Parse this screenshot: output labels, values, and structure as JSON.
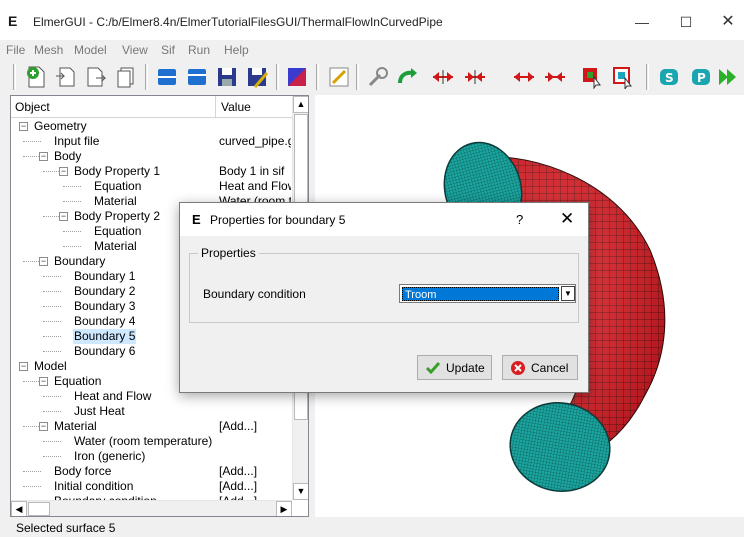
{
  "window": {
    "title": "ElmerGUI - C:/b/Elmer8.4n/ElmerTutorialFilesGUI/ThermalFlowInCurvedPipe",
    "logo": "E",
    "minimize": "—",
    "maximize": "☐",
    "close": "✕"
  },
  "menu": [
    "File",
    "Mesh",
    "Model",
    "View",
    "Sif",
    "Run",
    "Help"
  ],
  "tree": {
    "headers": {
      "object": "Object",
      "value": "Value"
    },
    "rows": [
      {
        "label": "Geometry",
        "value": "",
        "level": 0,
        "expander": "−"
      },
      {
        "label": "Input file",
        "value": "curved_pipe.g",
        "level": 1,
        "expander": ""
      },
      {
        "label": "Body",
        "value": "",
        "level": 1,
        "expander": "−"
      },
      {
        "label": "Body Property 1",
        "value": "Body 1 in sif",
        "level": 2,
        "expander": "−"
      },
      {
        "label": "Equation",
        "value": "Heat and Flow",
        "level": 3,
        "expander": ""
      },
      {
        "label": "Material",
        "value": "Water (room t",
        "level": 3,
        "expander": ""
      },
      {
        "label": "Body Property 2",
        "value": "",
        "level": 2,
        "expander": "−"
      },
      {
        "label": "Equation",
        "value": "",
        "level": 3,
        "expander": ""
      },
      {
        "label": "Material",
        "value": "",
        "level": 3,
        "expander": ""
      },
      {
        "label": "Boundary",
        "value": "",
        "level": 1,
        "expander": "−"
      },
      {
        "label": "Boundary 1",
        "value": "",
        "level": 2,
        "expander": ""
      },
      {
        "label": "Boundary 2",
        "value": "",
        "level": 2,
        "expander": ""
      },
      {
        "label": "Boundary 3",
        "value": "",
        "level": 2,
        "expander": ""
      },
      {
        "label": "Boundary 4",
        "value": "",
        "level": 2,
        "expander": ""
      },
      {
        "label": "Boundary 5",
        "value": "",
        "level": 2,
        "expander": "",
        "selected": true
      },
      {
        "label": "Boundary 6",
        "value": "",
        "level": 2,
        "expander": ""
      },
      {
        "label": "Model",
        "value": "",
        "level": 0,
        "expander": "−"
      },
      {
        "label": "Equation",
        "value": "",
        "level": 1,
        "expander": "−"
      },
      {
        "label": "Heat and Flow",
        "value": "",
        "level": 2,
        "expander": ""
      },
      {
        "label": "Just Heat",
        "value": "",
        "level": 2,
        "expander": ""
      },
      {
        "label": "Material",
        "value": "[Add...]",
        "level": 1,
        "expander": "−"
      },
      {
        "label": "Water (room temperature)",
        "value": "",
        "level": 2,
        "expander": ""
      },
      {
        "label": "Iron (generic)",
        "value": "",
        "level": 2,
        "expander": ""
      },
      {
        "label": "Body force",
        "value": "[Add...]",
        "level": 1,
        "expander": ""
      },
      {
        "label": "Initial condition",
        "value": "[Add...]",
        "level": 1,
        "expander": ""
      },
      {
        "label": "Boundary condition",
        "value": "[Add...]",
        "level": 1,
        "expander": ""
      }
    ]
  },
  "dialog": {
    "logo": "E",
    "title": "Properties for boundary 5",
    "help": "?",
    "close": "✕",
    "group_title": "Properties",
    "field_label": "Boundary condition",
    "field_value": "Troom",
    "update_label": "Update",
    "cancel_label": "Cancel"
  },
  "status": "Selected surface 5",
  "colors": {
    "mesh_body": "#e0141c",
    "mesh_cap": "#1aa6a0",
    "selection": "#0078d7"
  }
}
